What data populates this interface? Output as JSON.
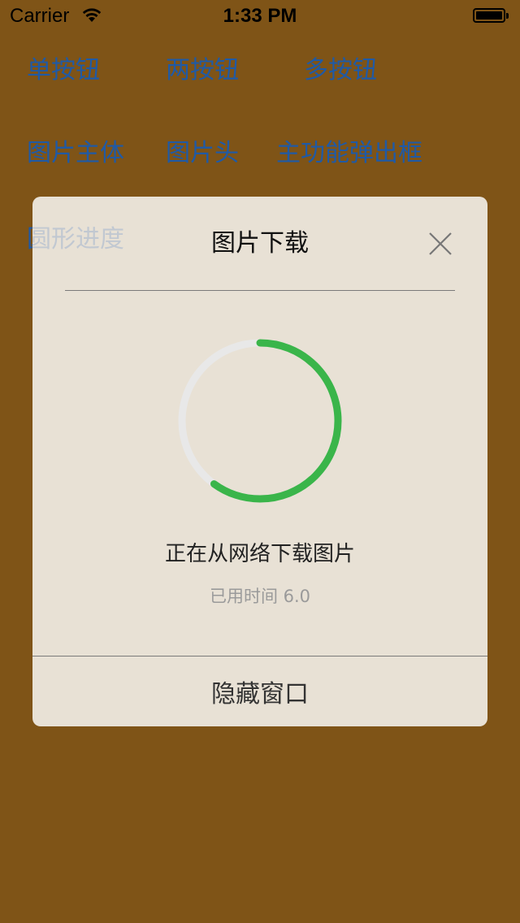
{
  "status_bar": {
    "carrier": "Carrier",
    "time": "1:33 PM"
  },
  "menu": {
    "single_button": "单按钮",
    "two_buttons": "两按钮",
    "multi_buttons": "多按钮",
    "image_body": "图片主体",
    "image_header": "图片头",
    "main_popup": "主功能弹出框",
    "circle_progress": "圆形进度"
  },
  "dialog": {
    "title": "图片下载",
    "message": "正在从网络下载图片",
    "elapsed": "已用时间 6.0",
    "hide_button": "隐藏窗口",
    "progress": 0.6
  },
  "colors": {
    "background": "#7f5417",
    "link": "#1f5aa6",
    "progress_fill": "#3ab54a",
    "progress_track": "#e8e8e8"
  },
  "icons": {
    "wifi": "wifi-icon",
    "battery": "battery-icon",
    "close": "close-icon"
  }
}
